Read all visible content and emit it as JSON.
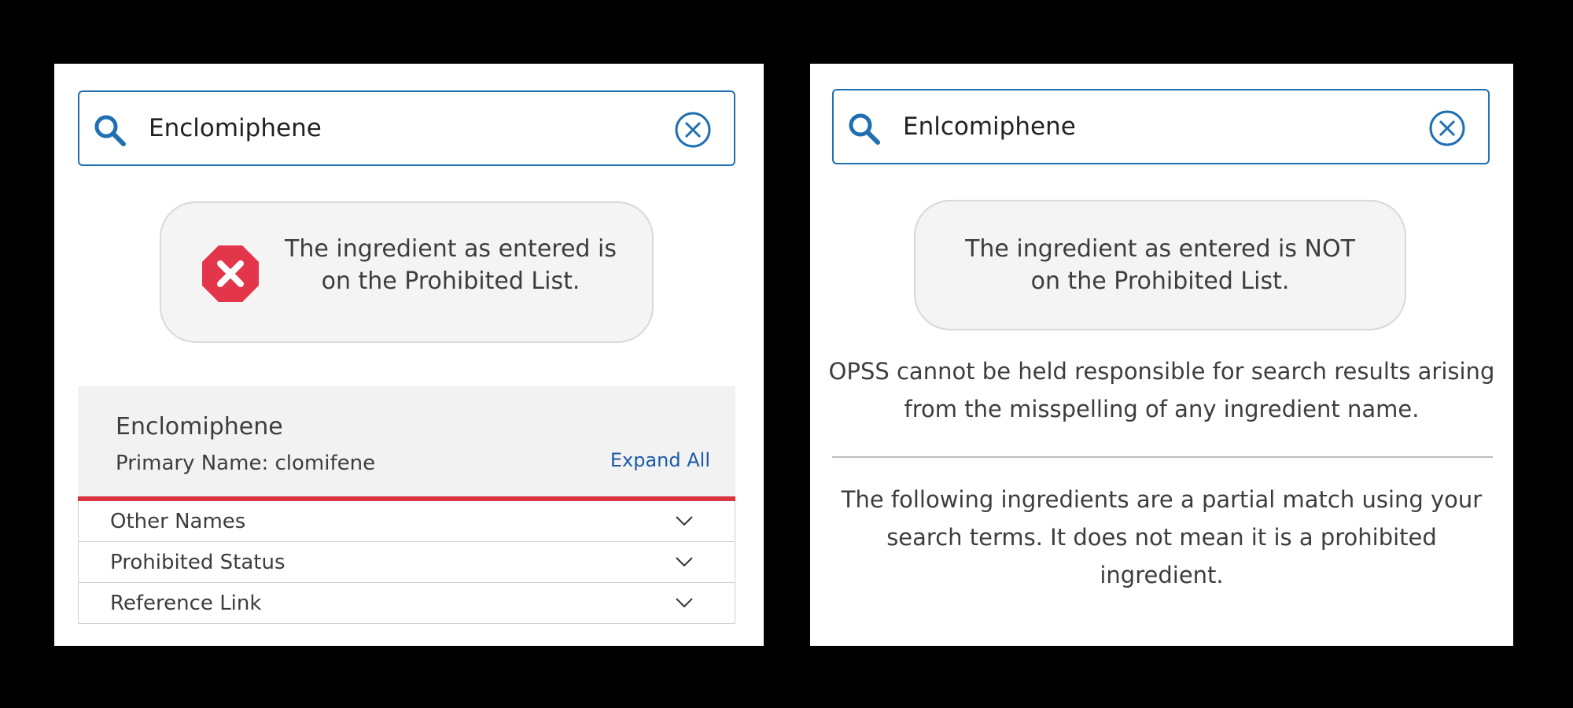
{
  "left": {
    "search": {
      "value": "Enclomiphene"
    },
    "status": {
      "line1": "The ingredient as entered is",
      "line2": "on the Prohibited List."
    },
    "result": {
      "title": "Enclomiphene",
      "primary_name": "Primary Name: clomifene",
      "expand_all": "Expand All"
    },
    "accordion": [
      {
        "label": "Other Names"
      },
      {
        "label": "Prohibited Status"
      },
      {
        "label": "Reference Link"
      }
    ]
  },
  "right": {
    "search": {
      "value": "Enlcomiphene"
    },
    "status": {
      "line1": "The ingredient as entered is NOT",
      "line2": "on the Prohibited List."
    },
    "disclaimer": {
      "line1": "OPSS cannot be held responsible for search results arising",
      "line2": "from the misspelling of any ingredient name."
    },
    "partial": {
      "line1": "The following ingredients are a partial match using your",
      "line2": "search terms. It does not mean it is a prohibited",
      "line3": "ingredient."
    }
  },
  "colors": {
    "accent": "#1f6fb2",
    "danger": "#e3364a",
    "rule": "#d9333f",
    "link": "#1c5aa6"
  },
  "icons": [
    "search-icon",
    "clear-icon",
    "stop-x-icon",
    "chevron-down-icon"
  ]
}
